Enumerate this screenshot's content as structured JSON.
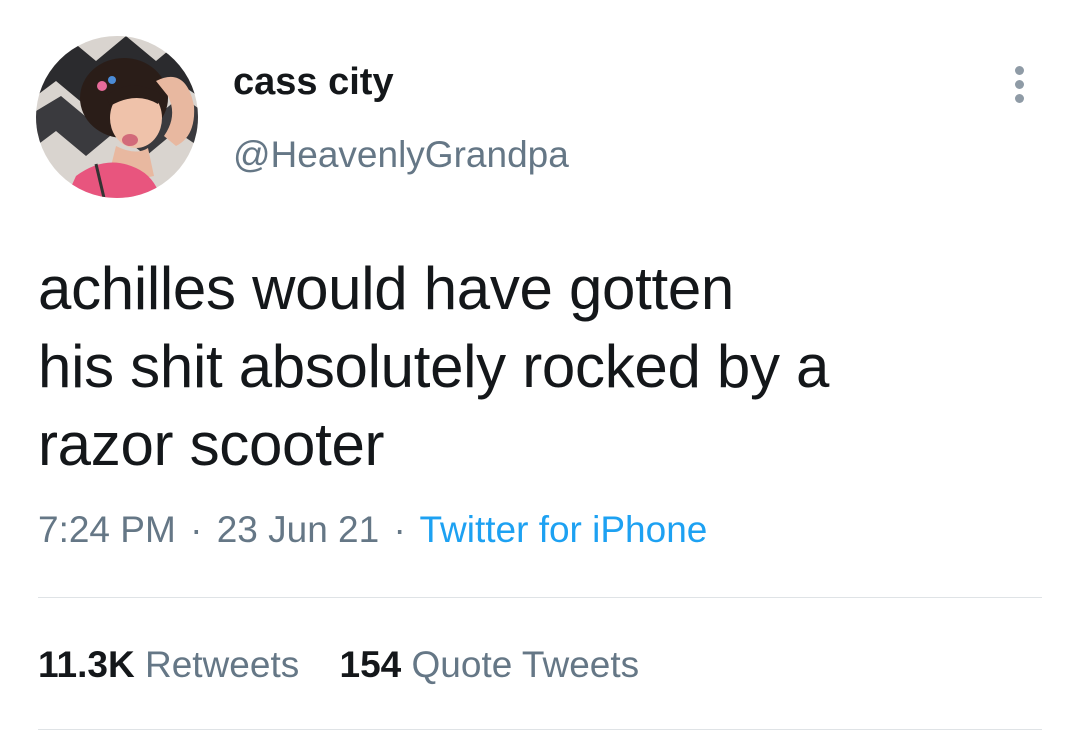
{
  "user": {
    "display_name": "cass city",
    "handle": "@HeavenlyGrandpa"
  },
  "tweet": {
    "lines": [
      "achilles would have gotten",
      "his shit absolutely rocked by a",
      "razor scooter"
    ],
    "time": "7:24 PM",
    "date": "23 Jun 21",
    "separator": "·",
    "source": "Twitter for iPhone"
  },
  "stats": {
    "retweets_count": "11.3K",
    "retweets_label": "Retweets",
    "quotes_count": "154",
    "quotes_label": "Quote Tweets"
  },
  "colors": {
    "text": "#14171a",
    "secondary": "#657786",
    "link": "#1da1f2",
    "divider": "#dfe3e6"
  },
  "icons": {
    "more": "more-vertical-icon",
    "avatar": "profile-photo"
  }
}
